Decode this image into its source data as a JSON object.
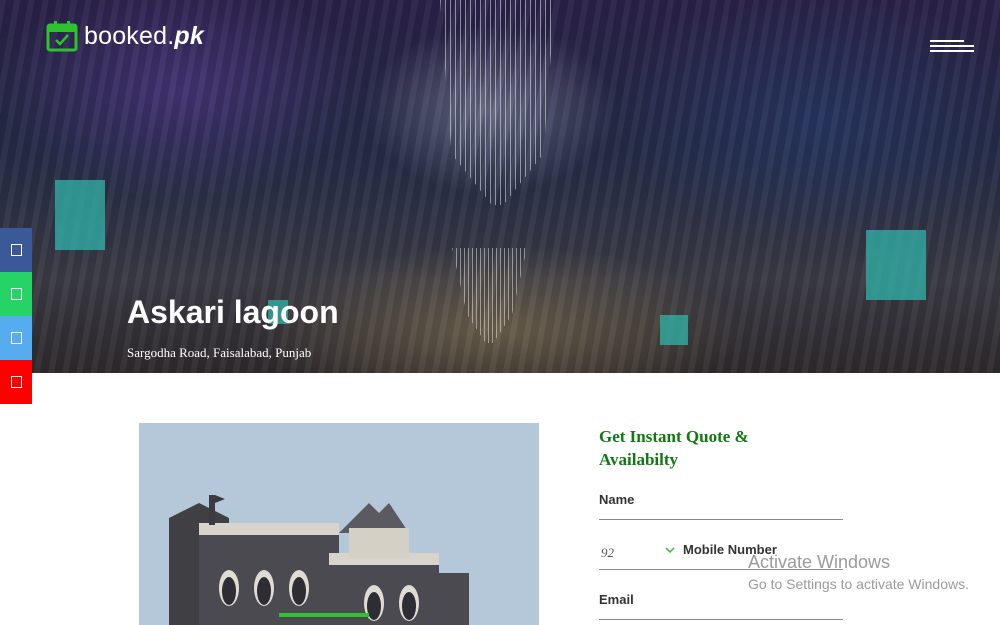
{
  "brand": {
    "name_prefix": "booked",
    "name_dot": ".",
    "name_suffix": "pk",
    "accent": "#2fc22f"
  },
  "hero": {
    "title": "Askari lagoon",
    "address": "Sargodha Road, Faisalabad, Punjab"
  },
  "social": [
    {
      "name": "facebook",
      "color": "#3b5998"
    },
    {
      "name": "whatsapp",
      "color": "#25d366"
    },
    {
      "name": "twitter",
      "color": "#55acee"
    },
    {
      "name": "youtube",
      "color": "#ff0000"
    }
  ],
  "form": {
    "title_line1": "Get Instant Quote &",
    "title_line2": "Availabilty",
    "name_label": "Name",
    "country_code": "92",
    "mobile_label": "Mobile Number",
    "email_label": "Email"
  },
  "watermark": {
    "line1": "Activate Windows",
    "line2": "Go to Settings to activate Windows."
  }
}
